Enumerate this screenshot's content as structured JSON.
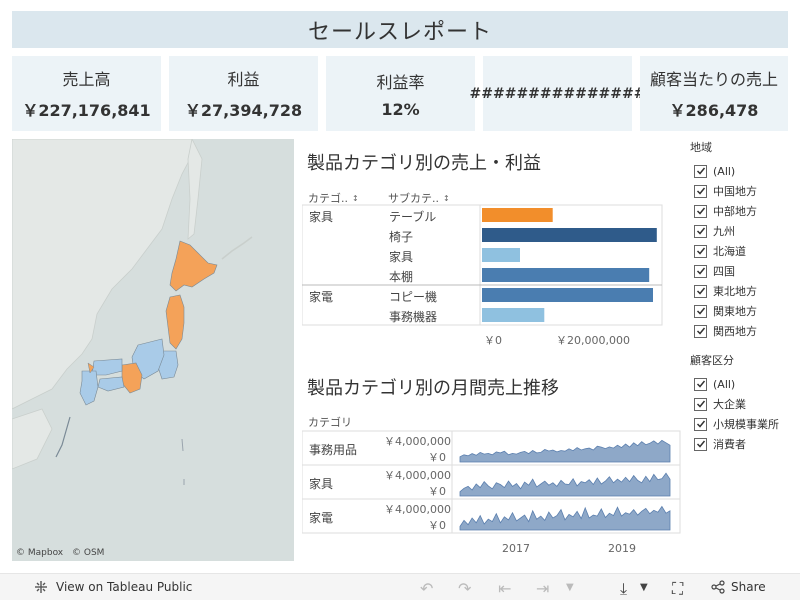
{
  "title": "セールスレポート",
  "kpis": [
    {
      "label": "売上高",
      "value": "￥227,176,841"
    },
    {
      "label": "利益",
      "value": "￥27,394,728"
    },
    {
      "label": "利益率",
      "value": "12%"
    },
    {
      "label": "",
      "value": "###############"
    },
    {
      "label": "顧客当たりの売上",
      "value": "￥286,478"
    }
  ],
  "map": {
    "credit_mapbox": "© Mapbox",
    "credit_osm": "© OSM"
  },
  "category_chart": {
    "title": "製品カテゴリ別の売上・利益",
    "col_category": "カテゴ..",
    "col_subcategory": "サブカテ..",
    "sort_icon": "↕",
    "groups": [
      {
        "category": "家具",
        "rows": [
          {
            "sub": "テーブル",
            "value": 9300000,
            "color": "#f28e2b"
          },
          {
            "sub": "椅子",
            "value": 23000000,
            "color": "#2f5b8a"
          },
          {
            "sub": "家具",
            "value": 5000000,
            "color": "#8fc1e0"
          },
          {
            "sub": "本棚",
            "value": 22000000,
            "color": "#4a7db0"
          }
        ]
      },
      {
        "category": "家電",
        "rows": [
          {
            "sub": "コピー機",
            "value": 22500000,
            "color": "#4a7db0"
          },
          {
            "sub": "事務機器",
            "value": 8200000,
            "color": "#8fc1e0"
          }
        ]
      }
    ],
    "axis_ticks": [
      "￥0",
      "￥20,000,000"
    ]
  },
  "monthly_chart": {
    "title": "製品カテゴリ別の月間売上推移",
    "col_category": "カテゴリ",
    "rows": [
      {
        "category": "事務用品",
        "tick_high": "￥4,000,000",
        "tick_low": "￥0",
        "values": [
          0.22,
          0.3,
          0.26,
          0.35,
          0.28,
          0.4,
          0.33,
          0.36,
          0.3,
          0.42,
          0.38,
          0.45,
          0.3,
          0.36,
          0.33,
          0.4,
          0.44,
          0.35,
          0.48,
          0.38,
          0.4,
          0.52,
          0.46,
          0.5,
          0.42,
          0.48,
          0.45,
          0.55,
          0.47,
          0.6,
          0.5,
          0.55,
          0.58,
          0.5,
          0.66,
          0.62,
          0.56,
          0.63,
          0.58,
          0.7,
          0.6,
          0.75,
          0.62,
          0.8,
          0.68,
          0.85,
          0.72,
          0.78,
          0.88,
          0.75,
          0.9,
          0.8,
          0.7
        ]
      },
      {
        "category": "家具",
        "tick_high": "￥4,000,000",
        "tick_low": "￥0",
        "values": [
          0.18,
          0.32,
          0.4,
          0.25,
          0.5,
          0.35,
          0.6,
          0.42,
          0.3,
          0.55,
          0.48,
          0.35,
          0.62,
          0.4,
          0.52,
          0.3,
          0.58,
          0.45,
          0.7,
          0.38,
          0.5,
          0.62,
          0.45,
          0.55,
          0.4,
          0.65,
          0.5,
          0.48,
          0.72,
          0.42,
          0.6,
          0.55,
          0.68,
          0.48,
          0.75,
          0.5,
          0.62,
          0.8,
          0.55,
          0.7,
          0.58,
          0.78,
          0.6,
          0.85,
          0.65,
          0.55,
          0.82,
          0.6,
          0.9,
          0.68,
          0.72,
          0.95,
          0.7
        ]
      },
      {
        "category": "家電",
        "tick_high": "￥4,000,000",
        "tick_low": "￥0",
        "values": [
          0.15,
          0.4,
          0.22,
          0.5,
          0.3,
          0.6,
          0.25,
          0.45,
          0.35,
          0.68,
          0.3,
          0.55,
          0.42,
          0.72,
          0.38,
          0.5,
          0.62,
          0.35,
          0.8,
          0.45,
          0.58,
          0.4,
          0.75,
          0.5,
          0.6,
          0.85,
          0.42,
          0.65,
          0.55,
          0.78,
          0.48,
          0.92,
          0.5,
          0.62,
          0.58,
          0.88,
          0.52,
          0.7,
          0.6,
          0.95,
          0.58,
          0.72,
          0.66,
          0.85,
          0.62,
          0.78,
          0.9,
          0.68,
          0.82,
          0.74,
          0.98,
          0.7,
          0.8
        ]
      }
    ],
    "x_ticks": [
      "2017",
      "2019"
    ]
  },
  "filters": {
    "region": {
      "title": "地域",
      "items": [
        "(All)",
        "中国地方",
        "中部地方",
        "九州",
        "北海道",
        "四国",
        "東北地方",
        "関東地方",
        "関西地方"
      ]
    },
    "segment": {
      "title": "顧客区分",
      "items": [
        "(All)",
        "大企業",
        "小規模事業所",
        "消費者"
      ]
    }
  },
  "footer": {
    "view_label": "View on Tableau Public",
    "share_label": "Share"
  },
  "colors": {
    "header_bg": "#dbe7ee",
    "kpi_bg": "#ecf3f7",
    "area_fill": "#8ea8c8",
    "area_stroke": "#5b7fae",
    "orange": "#f28e2b",
    "map_water": "#d6dedd"
  }
}
